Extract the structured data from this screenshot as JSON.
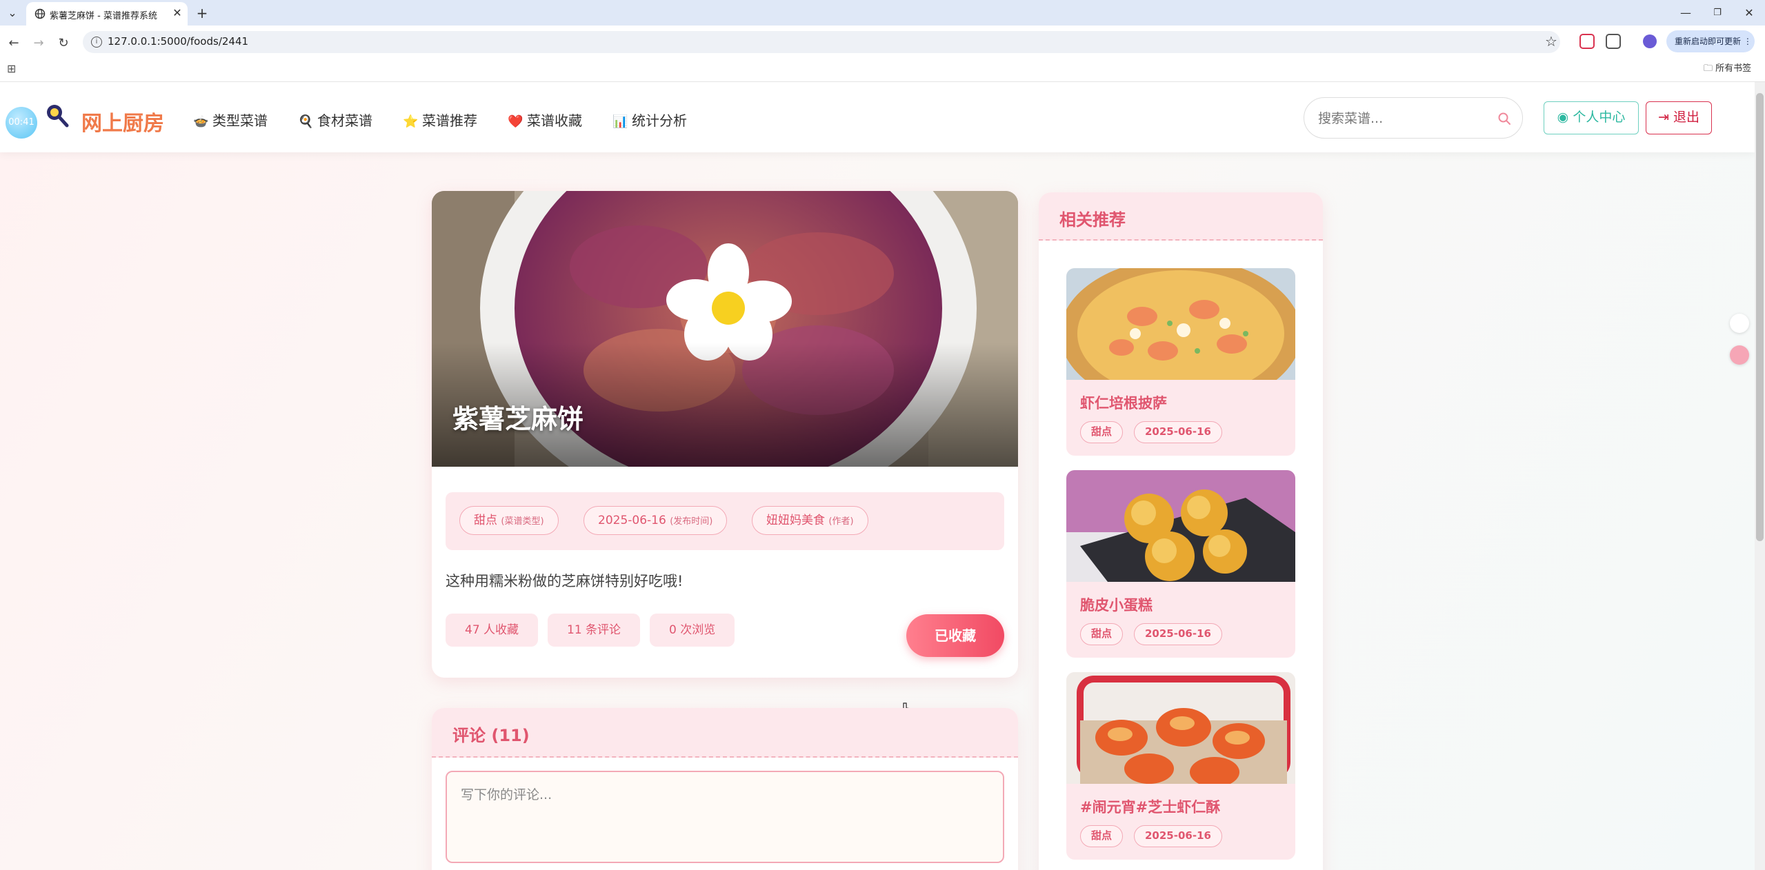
{
  "browser": {
    "tab_title": "紫薯芝麻饼 - 菜谱推荐系统",
    "url": "127.0.0.1:5000/foods/2441",
    "update_label": "重新启动即可更新 ⋮",
    "all_bookmarks": "所有书签"
  },
  "header": {
    "timer": "00:41",
    "logo": "网上厨房",
    "nav": [
      {
        "icon": "🍲",
        "label": "类型菜谱"
      },
      {
        "icon": "🍳",
        "label": "食材菜谱"
      },
      {
        "icon": "⭐",
        "label": "菜谱推荐"
      },
      {
        "icon": "❤️",
        "label": "菜谱收藏"
      },
      {
        "icon": "📊",
        "label": "统计分析"
      }
    ],
    "search_placeholder": "搜索菜谱...",
    "user_center": "个人中心",
    "logout": "退出"
  },
  "recipe": {
    "title": "紫薯芝麻饼",
    "category": "甜点",
    "category_note": "(菜谱类型)",
    "date": "2025-06-16",
    "date_note": "(发布时间)",
    "author": "妞妞妈美食",
    "author_note": "(作者)",
    "description": "这种用糯米粉做的芝麻饼特别好吃哦!",
    "favorites": "47 人收藏",
    "comments": "11 条评论",
    "views": "0 次浏览",
    "fav_button": "已收藏"
  },
  "comments": {
    "title": "评论 (11)",
    "placeholder": "写下你的评论..."
  },
  "sidebar": {
    "title": "相关推荐",
    "items": [
      {
        "name": "虾仁培根披萨",
        "tag": "甜点",
        "date": "2025-06-16"
      },
      {
        "name": "脆皮小蛋糕",
        "tag": "甜点",
        "date": "2025-06-16"
      },
      {
        "name": "#闹元宵#芝士虾仁酥",
        "tag": "甜点",
        "date": "2025-06-16"
      }
    ]
  }
}
